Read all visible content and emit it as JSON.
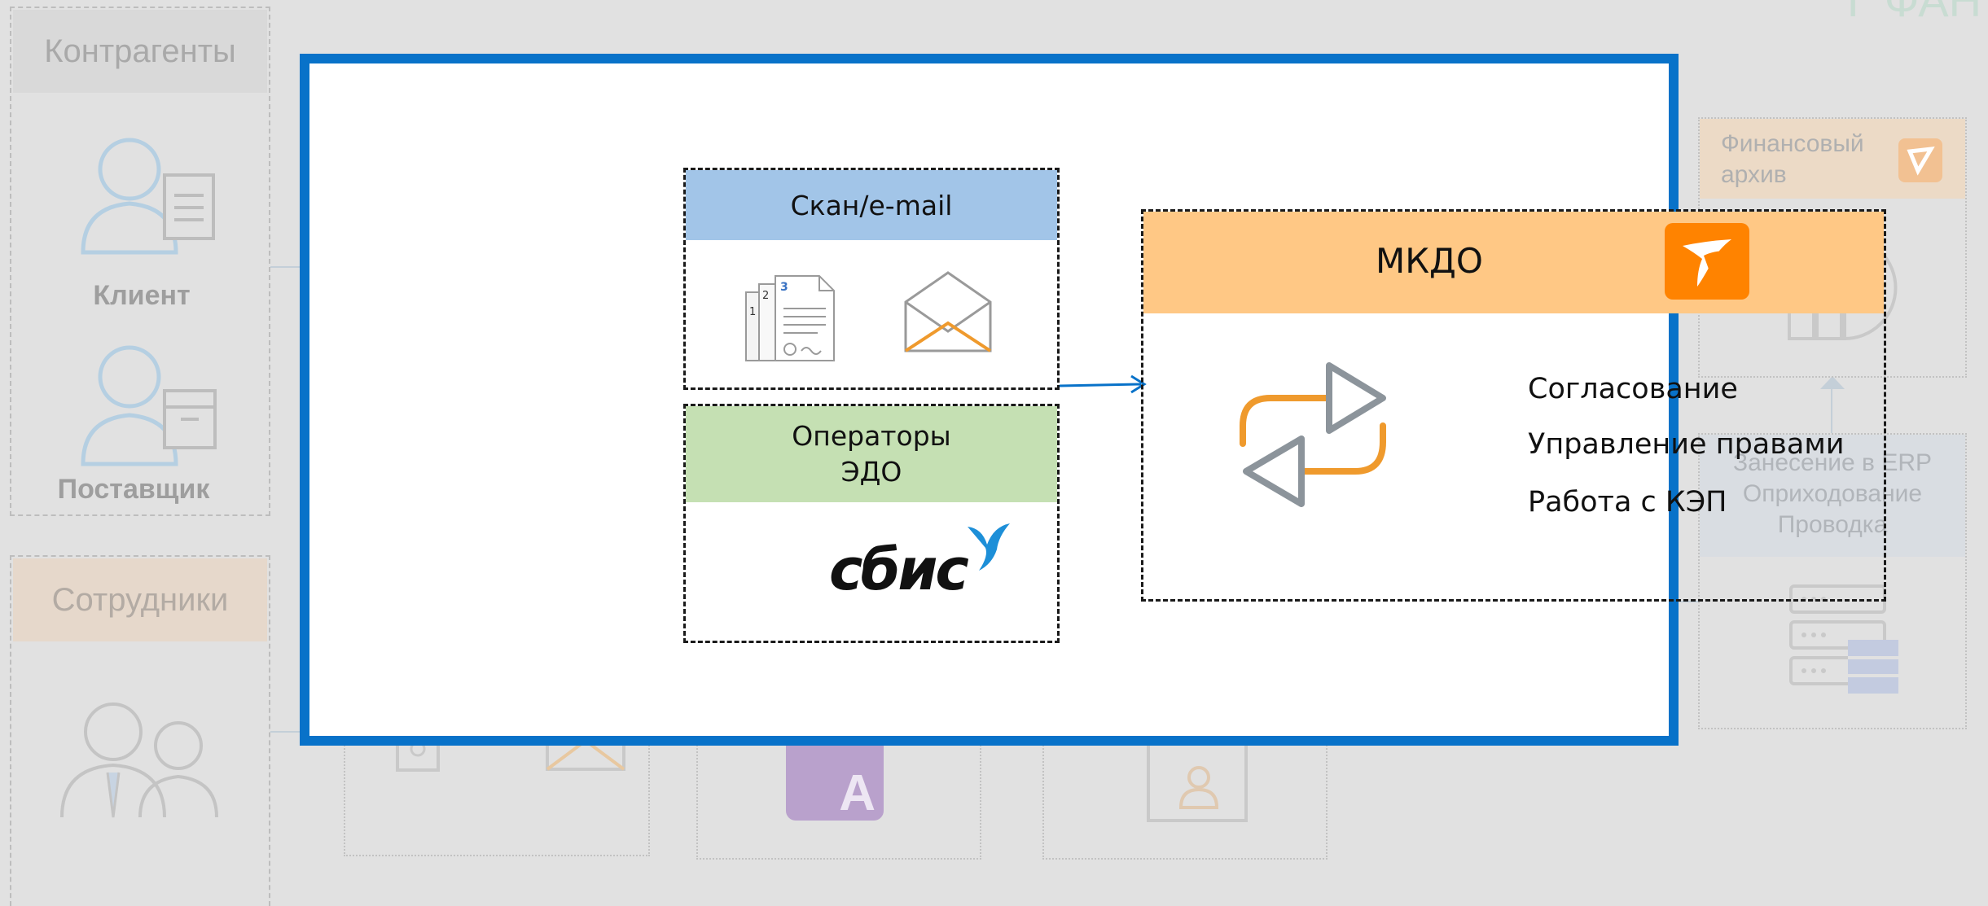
{
  "background": {
    "counterparties": {
      "title": "Контрагенты",
      "client_label": "Клиент",
      "supplier_label": "Поставщик"
    },
    "employees": {
      "title": "Сотрудники"
    },
    "finance_archive": {
      "title_line1": "Финансовый",
      "title_line2": "архив"
    },
    "erp": {
      "line1": "Занесение в ERP",
      "line2": "Оприходование",
      "line3": "Проводка"
    },
    "app_tile_letter": "A"
  },
  "panel": {
    "scan_email": {
      "title": "Скан/e-mail",
      "page_numbers": [
        "1",
        "2",
        "3"
      ]
    },
    "edo_operators": {
      "title_line1": "Операторы",
      "title_line2": "ЭДО",
      "logo_text": "сбис"
    },
    "mkdo": {
      "title": "МКДО",
      "features": [
        "Согласование",
        "Управление правами",
        "Работа с КЭП"
      ]
    }
  },
  "colors": {
    "panel_border": "#0872c9",
    "scan_header": "#a2c5e8",
    "edo_header": "#c5e0b3",
    "mkdo_header": "#ffc885",
    "logo_orange": "#ff8300",
    "cycle_orange": "#ef9a2d",
    "cycle_gray": "#8c949b",
    "sbis_blue": "#1d8fd8"
  },
  "icons": [
    "client-icon",
    "supplier-icon",
    "employees-icon",
    "archive-icon",
    "server-icon",
    "documents-icon",
    "envelope-icon",
    "sync-icon",
    "logo-icon",
    "bird-icon"
  ]
}
